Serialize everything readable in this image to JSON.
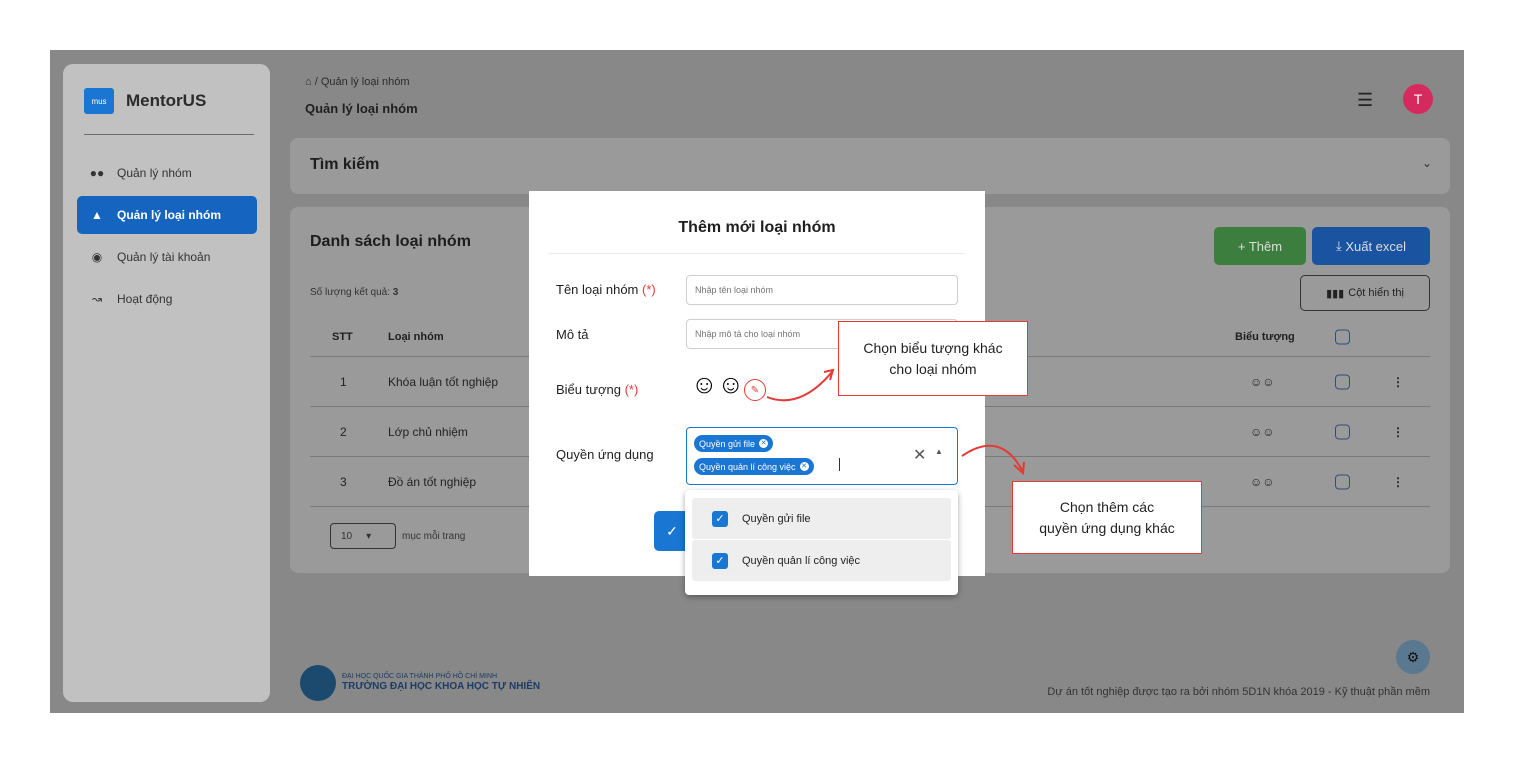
{
  "app": {
    "logo_badge": "mus",
    "name": "MentorUS"
  },
  "sidebar": {
    "items": [
      {
        "label": "Quản lý nhóm",
        "icon": "group-icon",
        "active": false
      },
      {
        "label": "Quản lý loại nhóm",
        "icon": "shapes-icon",
        "active": true
      },
      {
        "label": "Quản lý tài khoản",
        "icon": "account-circle-icon",
        "active": false
      },
      {
        "label": "Hoạt động",
        "icon": "activity-chart-icon",
        "active": false
      }
    ]
  },
  "header": {
    "breadcrumb_sep": "/",
    "breadcrumb_current": "Quản lý loại nhóm",
    "title": "Quản lý loại nhóm",
    "avatar_letter": "T"
  },
  "search": {
    "title": "Tìm kiếm"
  },
  "list": {
    "title": "Danh sách loại nhóm",
    "count_label": "Số lượng kết quả:",
    "count_value": "3",
    "add_label": "+ Thêm",
    "export_label": "Xuất excel",
    "columns_label": "Cột hiển thị",
    "headers": {
      "stt": "STT",
      "name": "Loại nhóm",
      "icon": "Biểu tượng"
    },
    "rows": [
      {
        "stt": "1",
        "name": "Khóa luận tốt nghiệp"
      },
      {
        "stt": "2",
        "name": "Lớp chủ nhiệm"
      },
      {
        "stt": "3",
        "name": "Đồ án tốt nghiệp"
      }
    ],
    "page_size": "10",
    "page_size_label": "mục mỗi trang"
  },
  "footer": {
    "uni_line1": "ĐẠI HỌC QUỐC GIA THÀNH PHỐ HỒ CHÍ MINH",
    "uni_line2": "TRƯỜNG ĐẠI HỌC KHOA HỌC TỰ NHIÊN",
    "credit": "Dự án tốt nghiệp được tạo ra bởi nhóm 5D1N khóa 2019 - Kỹ thuật phần mềm"
  },
  "modal": {
    "title": "Thêm mới loại nhóm",
    "name_label": "Tên loại nhóm",
    "required_mark": "(*)",
    "name_placeholder": "Nhập tên loại nhóm",
    "desc_label": "Mô tả",
    "desc_placeholder": "Nhập mô tả cho loại nhóm",
    "icon_label": "Biểu tượng",
    "perm_label": "Quyền ứng dụng",
    "chips": [
      "Quyền gửi file",
      "Quyền quản lí công việc"
    ],
    "options": [
      {
        "label": "Quyền gửi file",
        "checked": true
      },
      {
        "label": "Quyền quản lí công việc",
        "checked": true
      }
    ]
  },
  "callouts": {
    "icon_line1": "Chọn biểu tượng khác",
    "icon_line2": "cho loại nhóm",
    "perm_line1": "Chọn thêm các",
    "perm_line2": "quyền ứng dụng khác"
  },
  "colors": {
    "primary": "#1976d2",
    "required": "#e53935",
    "add_button": "#43a047",
    "avatar": "#d62a5f",
    "overlay": "#888888"
  }
}
